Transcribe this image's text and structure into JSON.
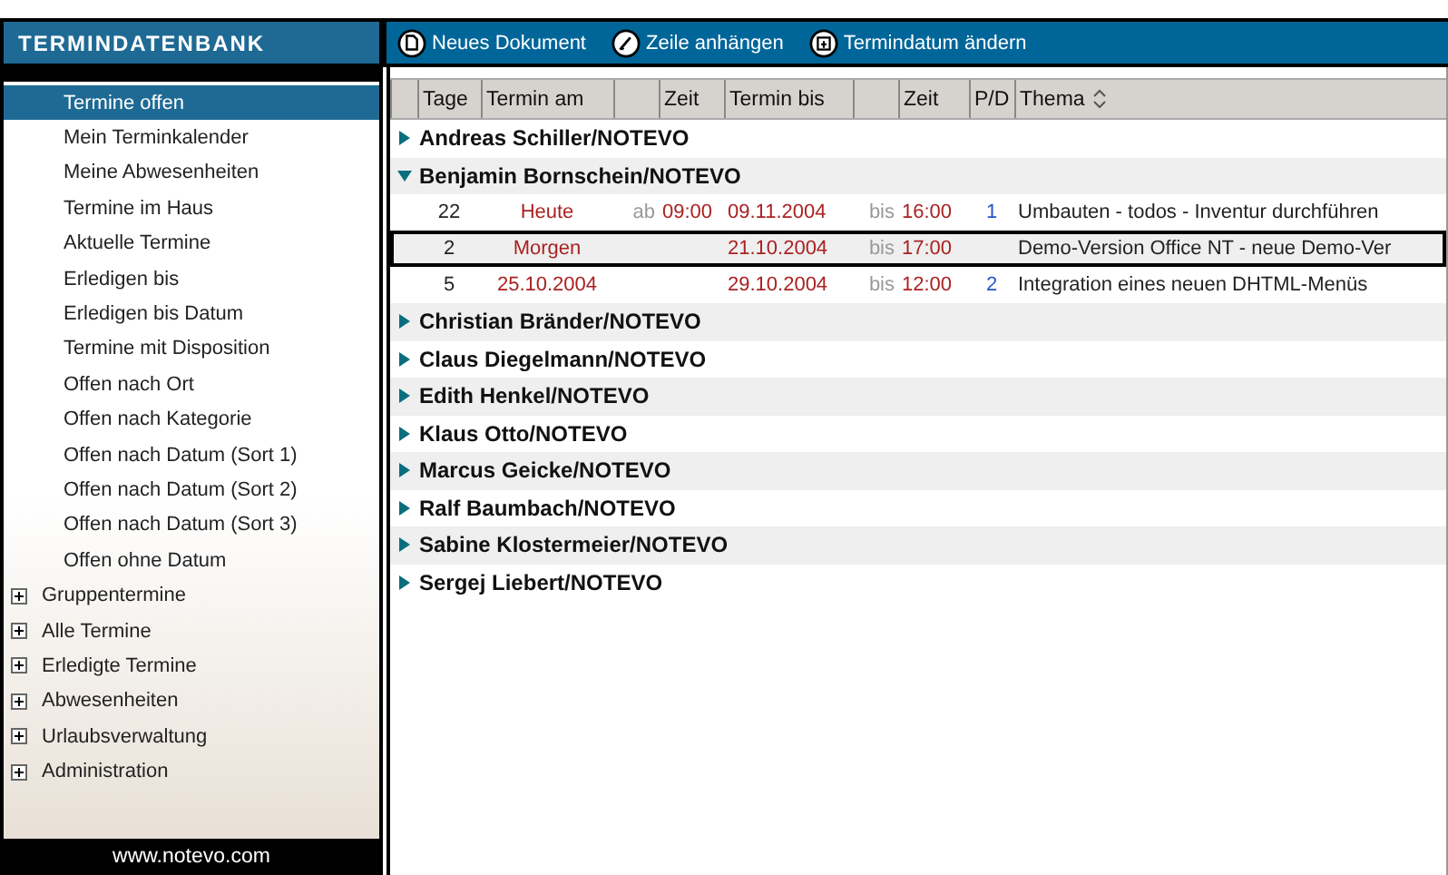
{
  "brand": "TERMINDATENBANK",
  "toolbar": [
    {
      "label": "Neues Dokument",
      "kind": "new"
    },
    {
      "label": "Zeile anhängen",
      "kind": "attach"
    },
    {
      "label": "Termindatum ändern",
      "kind": "date"
    }
  ],
  "sidebar": {
    "items": [
      {
        "label": "Termine offen",
        "kind": "view",
        "selected": true
      },
      {
        "label": "Mein Terminkalender",
        "kind": "view",
        "selected": false
      },
      {
        "label": "Meine Abwesenheiten",
        "kind": "view",
        "selected": false
      },
      {
        "label": "Termine im Haus",
        "kind": "view",
        "selected": false
      },
      {
        "label": "Aktuelle Termine",
        "kind": "view",
        "selected": false
      },
      {
        "label": "Erledigen bis",
        "kind": "view",
        "selected": false
      },
      {
        "label": "Erledigen bis Datum",
        "kind": "view",
        "selected": false
      },
      {
        "label": "Termine mit Disposition",
        "kind": "view",
        "selected": false
      },
      {
        "label": "Offen nach Ort",
        "kind": "view",
        "selected": false
      },
      {
        "label": "Offen nach Kategorie",
        "kind": "view",
        "selected": false
      },
      {
        "label": "Offen nach Datum (Sort 1)",
        "kind": "view",
        "selected": false
      },
      {
        "label": "Offen nach Datum (Sort 2)",
        "kind": "view",
        "selected": false
      },
      {
        "label": "Offen nach Datum (Sort 3)",
        "kind": "view",
        "selected": false
      },
      {
        "label": "Offen ohne Datum",
        "kind": "view",
        "selected": false
      },
      {
        "label": "Gruppentermine",
        "kind": "folder",
        "selected": false
      },
      {
        "label": "Alle Termine",
        "kind": "folder",
        "selected": false
      },
      {
        "label": "Erledigte Termine",
        "kind": "folder",
        "selected": false
      },
      {
        "label": "Abwesenheiten",
        "kind": "folder",
        "selected": false
      },
      {
        "label": "Urlaubsverwaltung",
        "kind": "folder",
        "selected": false
      },
      {
        "label": "Administration",
        "kind": "folder",
        "selected": false
      }
    ],
    "footer": "www.notevo.com"
  },
  "table": {
    "columns": [
      "Tage",
      "Termin am",
      "Zeit",
      "Termin bis",
      "Zeit",
      "P/D",
      "Thema"
    ],
    "groups": [
      {
        "name": "Andreas Schiller/NOTEVO",
        "expanded": false
      },
      {
        "name": "Benjamin Bornschein/NOTEVO",
        "expanded": true,
        "rows": [
          {
            "tage": "22",
            "termin_am": "Heute",
            "ab": "ab",
            "zeit_von": "09:00",
            "termin_bis": "09.11.2004",
            "bis": "bis",
            "zeit_bis": "16:00",
            "pd": "1",
            "thema": "Umbauten - todos - Inventur durchführen",
            "selected": false
          },
          {
            "tage": "2",
            "termin_am": "Morgen",
            "termin_bis": "21.10.2004",
            "bis": "bis",
            "zeit_bis": "17:00",
            "thema": "Demo-Version Office NT - neue Demo-Ver",
            "selected": true
          },
          {
            "tage": "5",
            "termin_am": "25.10.2004",
            "termin_bis": "29.10.2004",
            "bis": "bis",
            "zeit_bis": "12:00",
            "pd": "2",
            "thema": "Integration eines neuen DHTML-Menüs",
            "selected": false
          }
        ]
      },
      {
        "name": "Christian Bränder/NOTEVO",
        "expanded": false
      },
      {
        "name": "Claus Diegelmann/NOTEVO",
        "expanded": false
      },
      {
        "name": "Edith Henkel/NOTEVO",
        "expanded": false
      },
      {
        "name": "Klaus Otto/NOTEVO",
        "expanded": false
      },
      {
        "name": "Marcus Geicke/NOTEVO",
        "expanded": false
      },
      {
        "name": "Ralf Baumbach/NOTEVO",
        "expanded": false
      },
      {
        "name": "Sabine Klostermeier/NOTEVO",
        "expanded": false
      },
      {
        "name": "Sergej Liebert/NOTEVO",
        "expanded": false
      }
    ]
  }
}
